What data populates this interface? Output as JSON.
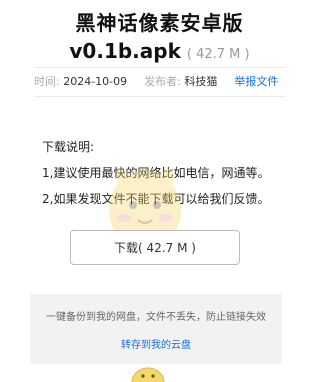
{
  "header": {
    "title_line1": "黑神话像素安卓版",
    "title_line2": "v0.1b.apk",
    "size": "( 42.7 M )"
  },
  "meta": {
    "time_label": "时间:",
    "time_value": "2024-10-09",
    "publisher_label": "发布者:",
    "publisher_value": "科技猫",
    "report_label": "举报文件"
  },
  "description": {
    "heading": "下载说明:",
    "line1": "1,建议使用最快的网络比如电信，网通等。",
    "line2": "2,如果发现文件不能下载可以给我们反馈。"
  },
  "download_button": "下载( 42.7 M )",
  "backup": {
    "note": "一键备份到我的网盘，文件不丢失，防止链接失效",
    "save_label": "转存到我的云盘"
  },
  "colors": {
    "link": "#1a6fd1",
    "panel_bg": "#f2f2f2",
    "border": "#bbbbbb"
  }
}
